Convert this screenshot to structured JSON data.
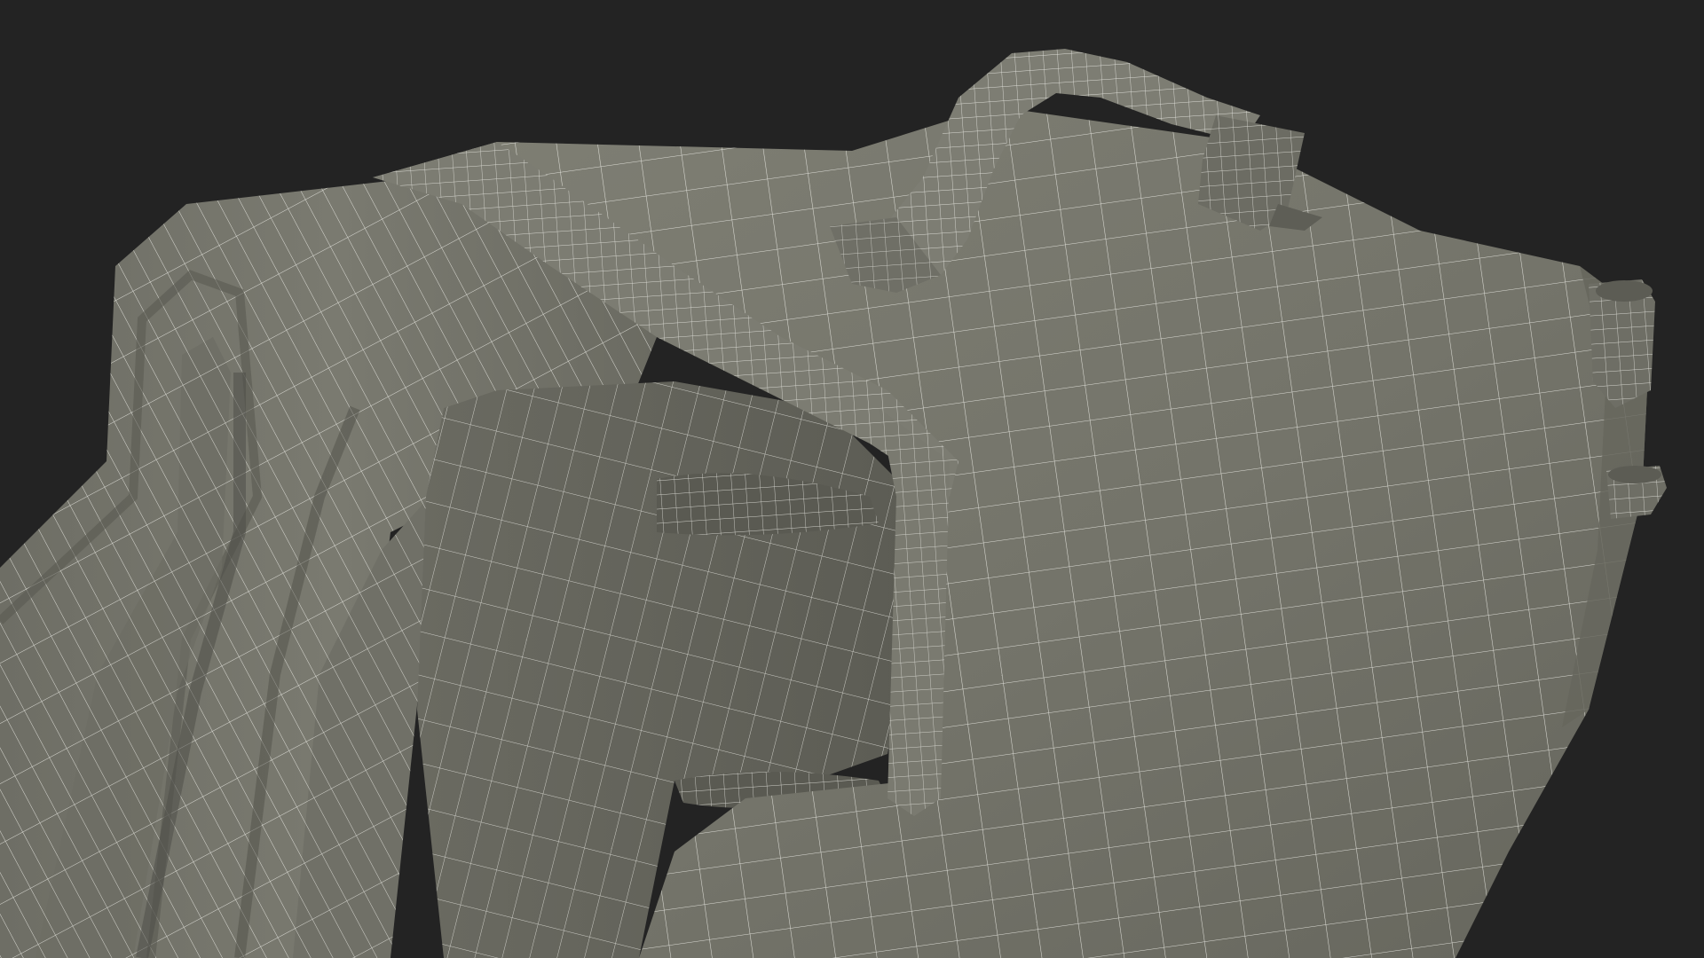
{
  "scene": {
    "background_color": "#232323",
    "surface_color": "#74746a",
    "surface_shadow_color": "#5f5f57",
    "surface_highlight_color": "#85857b",
    "wire_color": "#f2f2ec",
    "display_mode": "wireframe-on-shaded"
  },
  "objects": [
    {
      "name": "folded-fabric-layers"
    },
    {
      "name": "rolled-sleeping-mat"
    },
    {
      "name": "backpack-body"
    },
    {
      "name": "top-carry-handle"
    },
    {
      "name": "strap-buckle-loop"
    },
    {
      "name": "side-buckle-upper"
    },
    {
      "name": "side-buckle-lower"
    }
  ]
}
